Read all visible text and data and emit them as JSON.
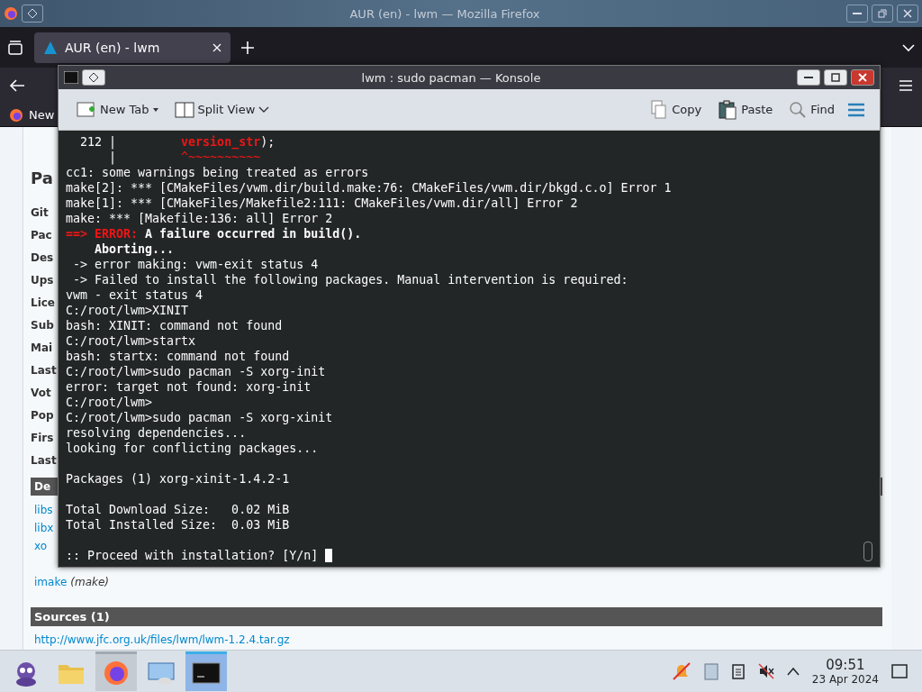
{
  "firefox": {
    "title": "AUR (en) - lwm — Mozilla Firefox",
    "tabs": [
      {
        "label": "AUR (en) - lwm",
        "selected": true
      }
    ],
    "bookmarks": [
      {
        "label": "New"
      }
    ],
    "page": {
      "heading": "Pa",
      "details": [
        "Git",
        "Pac",
        "Des",
        "Ups",
        "Lice",
        "Sub",
        "Mai",
        "Last",
        "Vot",
        "Pop",
        "Firs",
        "Last"
      ],
      "deps_header": "De",
      "deps": [
        {
          "name": "libs"
        },
        {
          "name": "libx"
        },
        {
          "name": "xo"
        },
        {
          "name": "imake",
          "note": "(make)"
        }
      ],
      "sources_header": "Sources (1)",
      "sources": [
        "http://www.jfc.org.uk/files/lwm/lwm-1.2.4.tar.gz"
      ]
    }
  },
  "konsole": {
    "title": "lwm : sudo pacman — Konsole",
    "toolbar_left": [
      {
        "label": "New Tab",
        "kind": "newtab"
      },
      {
        "label": "Split View",
        "kind": "split"
      }
    ],
    "toolbar_right": [
      {
        "label": "Copy",
        "kind": "copy"
      },
      {
        "label": "Paste",
        "kind": "paste"
      },
      {
        "label": "Find",
        "kind": "find"
      }
    ],
    "lines": [
      {
        "kind": "text",
        "segments": [
          {
            "text": "  212 |         ",
            "kind": "plain"
          },
          {
            "text": "version_str",
            "kind": "error_bold"
          },
          {
            "text": ");",
            "kind": "plain"
          }
        ]
      },
      {
        "kind": "text",
        "segments": [
          {
            "text": "      |         ",
            "kind": "plain"
          },
          {
            "text": "^~~~~~~~~~~",
            "kind": "error"
          }
        ]
      },
      {
        "kind": "text",
        "segments": [
          {
            "text": "cc1: some warnings being treated as errors",
            "kind": "plain"
          }
        ]
      },
      {
        "kind": "text",
        "segments": [
          {
            "text": "make[2]: *** [CMakeFiles/vwm.dir/build.make:76: CMakeFiles/vwm.dir/bkgd.c.o] Error 1",
            "kind": "plain"
          }
        ]
      },
      {
        "kind": "text",
        "segments": [
          {
            "text": "make[1]: *** [CMakeFiles/Makefile2:111: CMakeFiles/vwm.dir/all] Error 2",
            "kind": "plain"
          }
        ]
      },
      {
        "kind": "text",
        "segments": [
          {
            "text": "make: *** [Makefile:136: all] Error 2",
            "kind": "plain"
          }
        ]
      },
      {
        "kind": "text",
        "segments": [
          {
            "text": "==> ERROR:",
            "kind": "error_bold"
          },
          {
            "text": " A failure occurred in build().",
            "kind": "bold"
          }
        ]
      },
      {
        "kind": "text",
        "segments": [
          {
            "text": "    Aborting...",
            "kind": "bold"
          }
        ]
      },
      {
        "kind": "text",
        "segments": [
          {
            "text": " -> error making: vwm-exit status 4",
            "kind": "plain"
          }
        ]
      },
      {
        "kind": "text",
        "segments": [
          {
            "text": " -> Failed to install the following packages. Manual intervention is required:",
            "kind": "plain"
          }
        ]
      },
      {
        "kind": "text",
        "segments": [
          {
            "text": "vwm - exit status 4",
            "kind": "plain"
          }
        ]
      },
      {
        "kind": "text",
        "segments": [
          {
            "text": "C:/root/lwm>XINIT",
            "kind": "plain"
          }
        ]
      },
      {
        "kind": "text",
        "segments": [
          {
            "text": "bash: XINIT: command not found",
            "kind": "plain"
          }
        ]
      },
      {
        "kind": "text",
        "segments": [
          {
            "text": "C:/root/lwm>startx",
            "kind": "plain"
          }
        ]
      },
      {
        "kind": "text",
        "segments": [
          {
            "text": "bash: startx: command not found",
            "kind": "plain"
          }
        ]
      },
      {
        "kind": "text",
        "segments": [
          {
            "text": "C:/root/lwm>sudo pacman -S xorg-init",
            "kind": "plain"
          }
        ]
      },
      {
        "kind": "text",
        "segments": [
          {
            "text": "error: target not found: xorg-init",
            "kind": "plain"
          }
        ]
      },
      {
        "kind": "text",
        "segments": [
          {
            "text": "C:/root/lwm>",
            "kind": "plain"
          }
        ]
      },
      {
        "kind": "text",
        "segments": [
          {
            "text": "C:/root/lwm>sudo pacman -S xorg-xinit",
            "kind": "plain"
          }
        ]
      },
      {
        "kind": "text",
        "segments": [
          {
            "text": "resolving dependencies...",
            "kind": "plain"
          }
        ]
      },
      {
        "kind": "text",
        "segments": [
          {
            "text": "looking for conflicting packages...",
            "kind": "plain"
          }
        ]
      },
      {
        "kind": "blank"
      },
      {
        "kind": "text",
        "segments": [
          {
            "text": "Packages (1) xorg-xinit-1.4.2-1",
            "kind": "plain"
          }
        ]
      },
      {
        "kind": "blank"
      },
      {
        "kind": "text",
        "segments": [
          {
            "text": "Total Download Size:   0.02 MiB",
            "kind": "plain"
          }
        ]
      },
      {
        "kind": "text",
        "segments": [
          {
            "text": "Total Installed Size:  0.03 MiB",
            "kind": "plain"
          }
        ]
      },
      {
        "kind": "blank"
      },
      {
        "kind": "text",
        "cursor": true,
        "segments": [
          {
            "text": ":: Proceed with installation? [Y/n]",
            "kind": "plain"
          }
        ]
      }
    ]
  },
  "taskbar": {
    "items": [
      {
        "kind": "launcher",
        "focused": false,
        "open": false
      },
      {
        "kind": "files",
        "focused": false,
        "open": false
      },
      {
        "kind": "browser",
        "focused": false,
        "open": true
      },
      {
        "kind": "settings",
        "focused": false,
        "open": false
      },
      {
        "kind": "terminal",
        "focused": true,
        "open": true
      }
    ],
    "time": "09:51",
    "date": "23 Apr 2024"
  }
}
